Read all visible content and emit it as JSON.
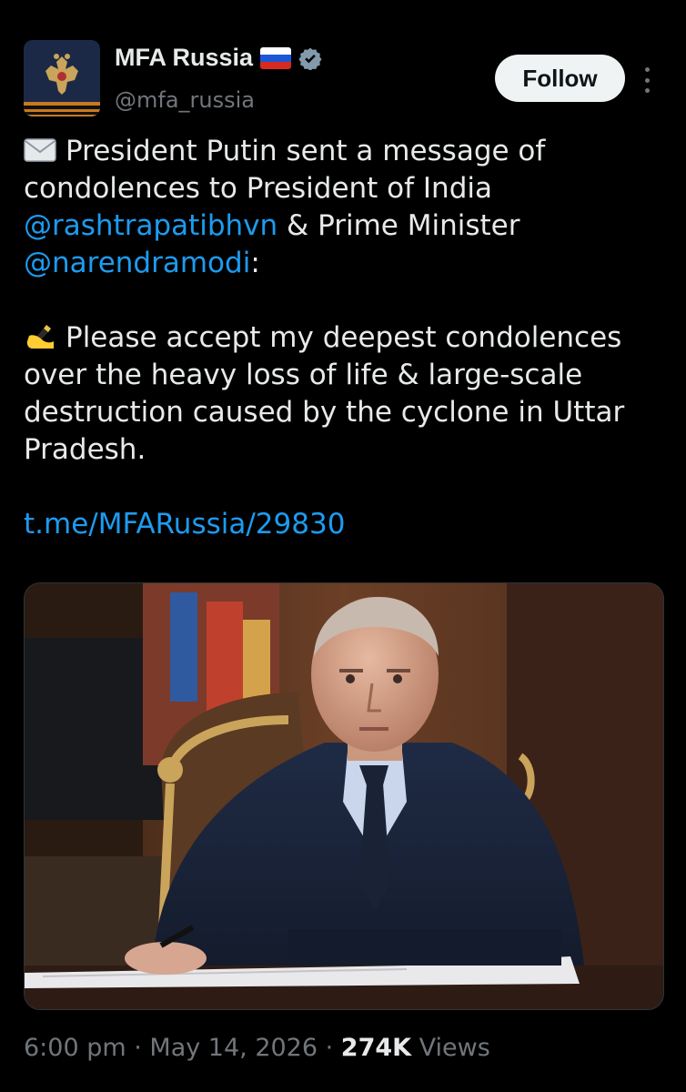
{
  "account": {
    "display_name": "MFA Russia",
    "handle": "@mfa_russia",
    "flag_icon": "russia-flag-icon",
    "verified_icon": "verified-badge-icon",
    "verified_color": "#1d9bf0"
  },
  "follow_label": "Follow",
  "tweet": {
    "para1": {
      "emoji": "envelope-icon",
      "t1": "President Putin sent a message of condolences to President of India ",
      "m1": "@rashtrapatibhvn",
      "t2": " & Prime Minister ",
      "m2": "@narendramodi",
      "t3": ":"
    },
    "para2": {
      "emoji": "writing-hand-icon",
      "t1": "Please accept my deepest condolences over the heavy loss of life & large-scale destruction caused by the cyclone in Uttar Pradesh."
    },
    "link": "t.me/MFARussia/29830"
  },
  "meta": {
    "time": "6:00 pm",
    "sep": " · ",
    "date": "May 14, 2026",
    "views_count": "274K",
    "views_label": " Views"
  },
  "colors": {
    "background": "#000000",
    "text": "#e7e9ea",
    "secondary": "#71767b",
    "link": "#1d9bf0"
  }
}
